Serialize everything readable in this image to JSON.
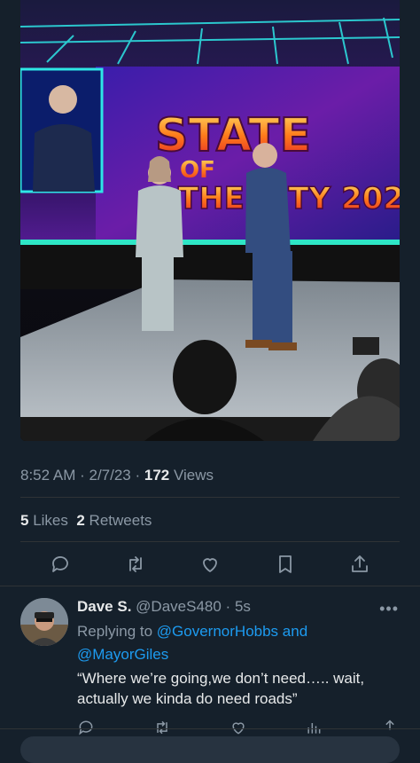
{
  "photo": {
    "sign_line1": "STATE",
    "sign_line2": "OF",
    "sign_line3": "THE CITY 202"
  },
  "tweet": {
    "time": "8:52 AM",
    "date": "2/7/23",
    "views_count": "172",
    "views_label": "Views",
    "likes_count": "5",
    "likes_label": "Likes",
    "retweets_count": "2",
    "retweets_label": "Retweets"
  },
  "actions": {
    "reply": "reply-icon",
    "retweet": "retweet-icon",
    "like": "heart-icon",
    "bookmark": "bookmark-icon",
    "share": "share-icon"
  },
  "reply": {
    "name": "Dave S.",
    "handle": "@DaveS480",
    "time": "5s",
    "replying_to_label": "Replying to",
    "mention1": "@GovernorHobbs",
    "and_label": "and",
    "mention2": "@MayorGiles",
    "text": "“Where we’re going,we don’t need….. wait, actually we kinda do need roads”"
  },
  "colors": {
    "background": "#15202b",
    "link": "#1d9bf0",
    "muted": "#8b98a5"
  }
}
